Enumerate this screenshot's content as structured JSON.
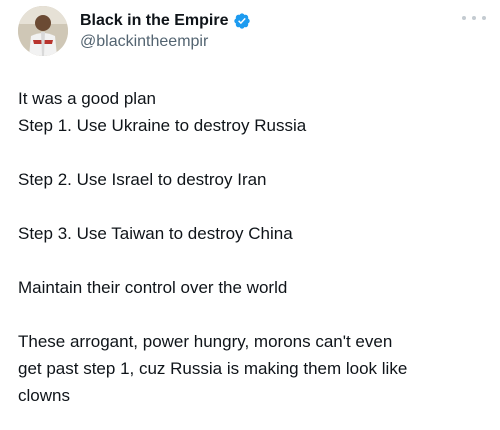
{
  "author": {
    "display_name": "Black in the Empire",
    "handle": "@blackintheempir",
    "verified_icon": "verified-badge-icon",
    "avatar_icon": "avatar"
  },
  "menu": {
    "icon": "more-options-icon"
  },
  "tweet": {
    "lines": [
      "It was a good plan",
      "Step 1.  Use Ukraine to destroy Russia",
      "Step 2. Use Israel to destroy Iran",
      "Step 3. Use Taiwan to destroy China",
      "Maintain their control over the world",
      "These arrogant, power hungry, morons can't even",
      "get past step 1, cuz Russia is making them look like",
      "clowns"
    ]
  },
  "colors": {
    "text": "#0f1419",
    "secondary_text": "#536471",
    "verified_blue": "#1d9bf0",
    "more_dots": "#c4cbd1"
  }
}
